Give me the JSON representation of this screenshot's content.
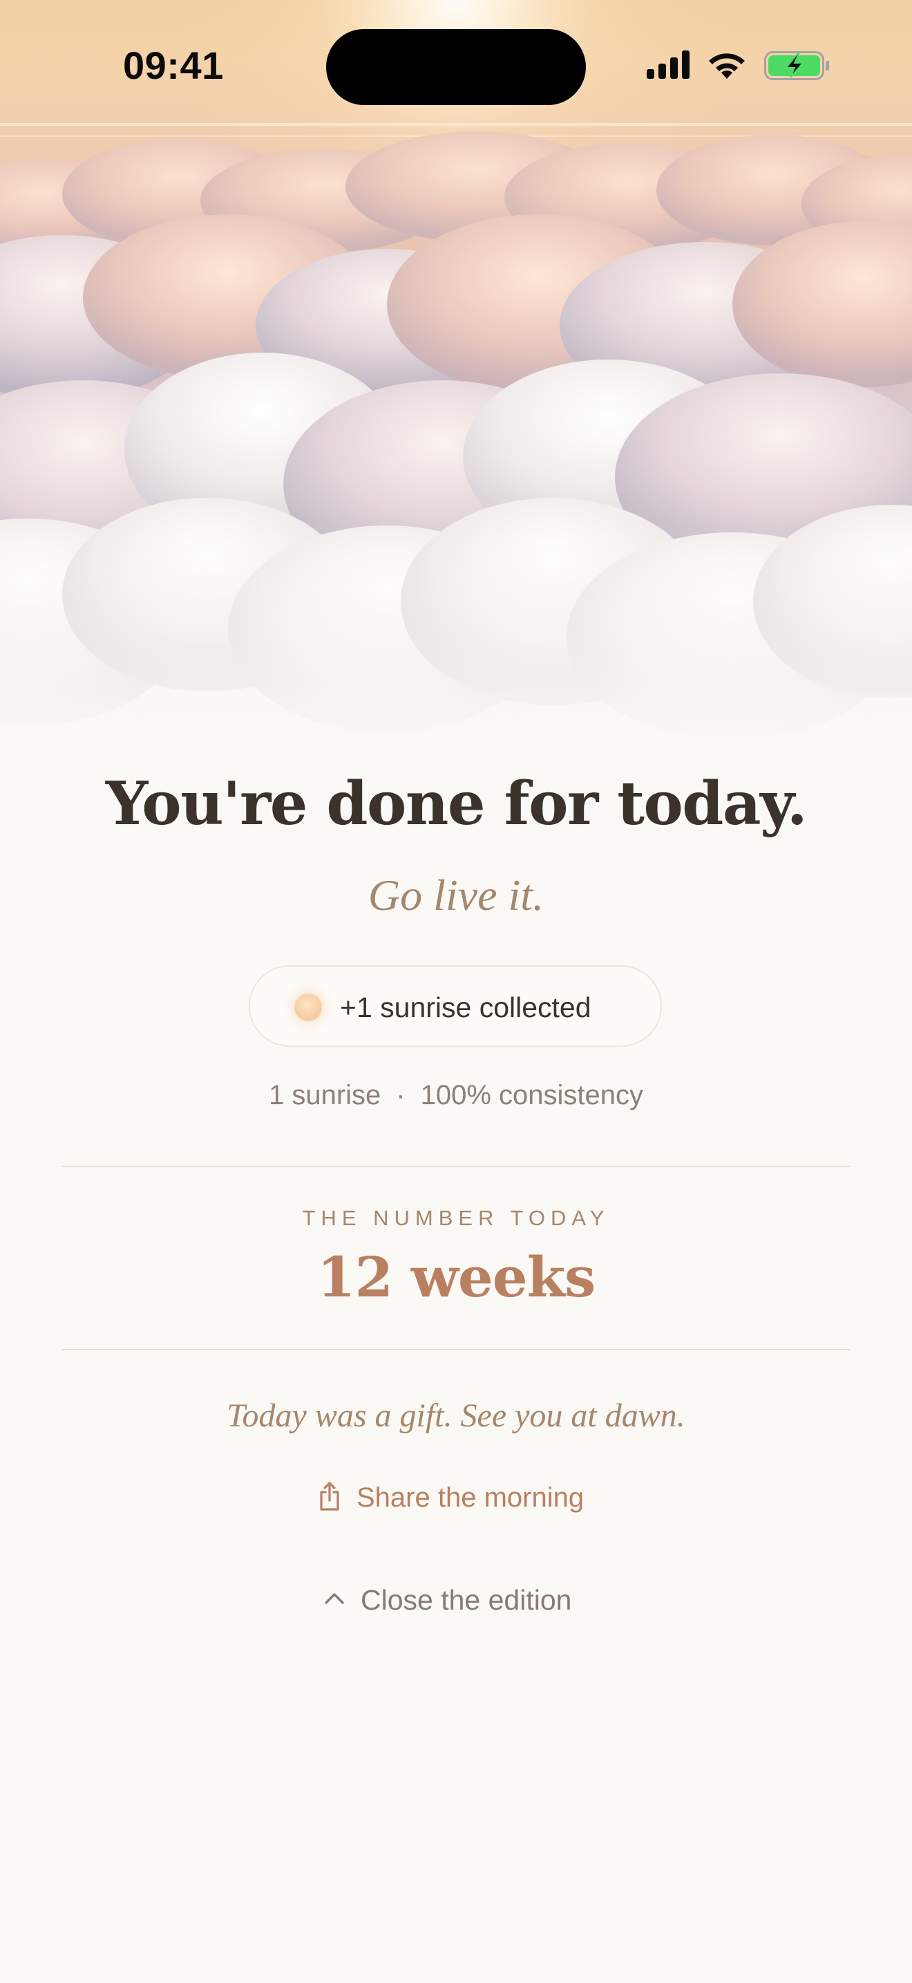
{
  "status_bar": {
    "time": "09:41"
  },
  "hero": {
    "scene": "sunrise-above-clouds"
  },
  "headline": "You're done for today.",
  "subline": "Go live it.",
  "badge": {
    "label": "+1 sunrise collected"
  },
  "stats": {
    "sunrises": "1 sunrise",
    "separator": "·",
    "consistency": "100% consistency"
  },
  "number_today": {
    "eyebrow": "THE NUMBER TODAY",
    "value": "12 weeks"
  },
  "closing_line": "Today was a gift. See you at dawn.",
  "share": {
    "label": "Share the morning",
    "icon": "share-icon"
  },
  "close": {
    "label": "Close the edition",
    "icon": "chevron-up-icon"
  },
  "colors": {
    "background": "#fbf9f5",
    "text_primary": "#3a322b",
    "accent": "#b88061",
    "muted_accent": "#a4876d",
    "muted": "#8b8178",
    "battery_fill": "#4cd964"
  }
}
